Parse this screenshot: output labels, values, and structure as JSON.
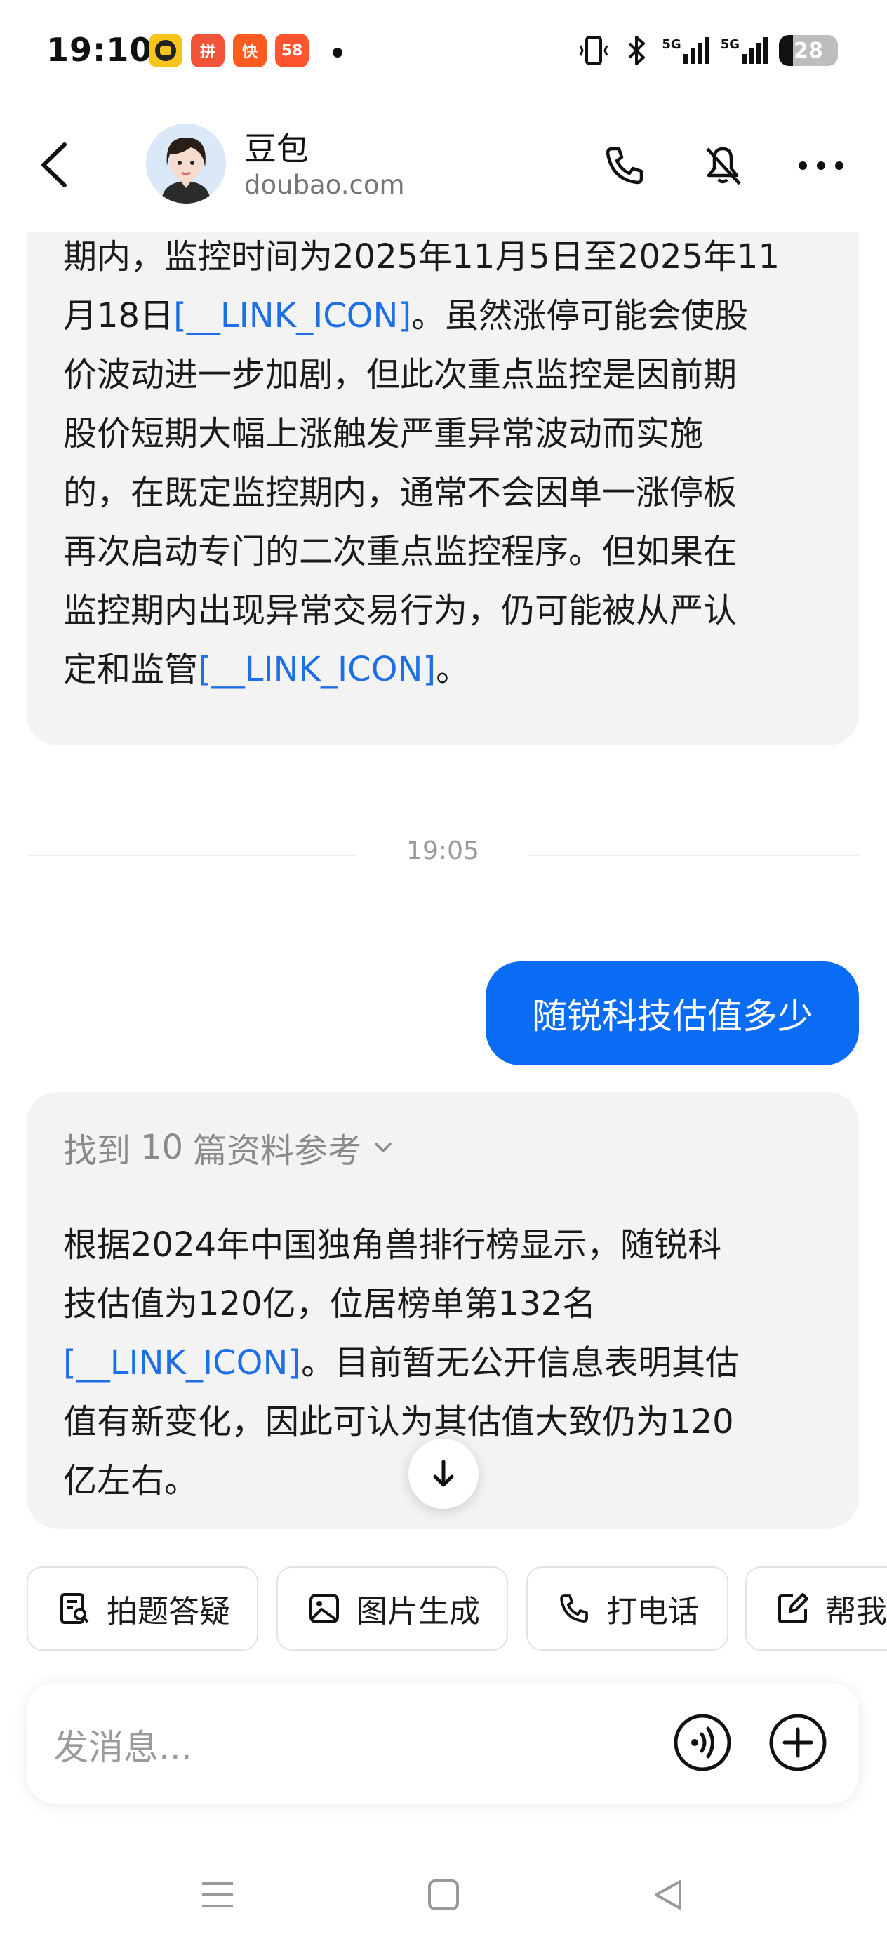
{
  "status_bar": {
    "time": "19:10",
    "notification_apps": [
      {
        "name": "app-yellow-icon",
        "label": "",
        "color": "#f5c51c"
      },
      {
        "name": "app-pinduoduo-icon",
        "label": "拼",
        "color": "#f2543a"
      },
      {
        "name": "app-kuaishou-icon",
        "label": "快",
        "color": "#ff5a1f"
      },
      {
        "name": "app-58-icon",
        "label": "58",
        "color": "#ff552e"
      }
    ],
    "signal_1": "5G",
    "signal_2": "5G",
    "battery": "28",
    "battery_level": 0.28
  },
  "header": {
    "bot_name": "豆包",
    "bot_domain": "doubao.com",
    "icons": [
      "back-arrow-icon",
      "phone-icon",
      "mute-icon",
      "more-icon"
    ]
  },
  "messages": [
    {
      "role": "assistant",
      "lines": [
        "期内，监控时间为2025年11月5日至2025年11",
        "月18日[__LINK_ICON]。虽然涨停可能会使股",
        "价波动进一步加剧，但此次重点监控是因前期",
        "股价短期大幅上涨触发严重异常波动而实施",
        "的，在既定监控期内，通常不会因单一涨停板",
        "再次启动专门的二次重点监控程序。但如果在",
        "监控期内出现异常交易行为，仍可能被从严认",
        "定和监管[__LINK_ICON]。"
      ]
    },
    {
      "role": "divider",
      "time": "19:05"
    },
    {
      "role": "user",
      "text": "随锐科技估值多少"
    },
    {
      "role": "assistant",
      "refs": {
        "prefix": "找到",
        "count": "10",
        "suffix": "篇资料参考"
      },
      "lines": [
        "根据2024年中国独角兽排行榜显示，随锐科",
        "技估值为120亿，位居榜单第132名",
        "[__LINK_ICON]。目前暂无公开信息表明其估",
        "值有新变化，因此可认为其估值大致仍为120",
        "亿左右。"
      ]
    }
  ],
  "quick_actions": [
    {
      "label": "拍题答疑",
      "icon": "photo-question-icon"
    },
    {
      "label": "图片生成",
      "icon": "image-icon"
    },
    {
      "label": "打电话",
      "icon": "phone-icon"
    },
    {
      "label": "帮我",
      "icon": "edit-icon"
    }
  ],
  "input": {
    "placeholder": "发消息..."
  },
  "colors": {
    "accent": "#0a6cf5",
    "link": "#1e6fe6",
    "bubble_bg": "#f3f3f3"
  }
}
